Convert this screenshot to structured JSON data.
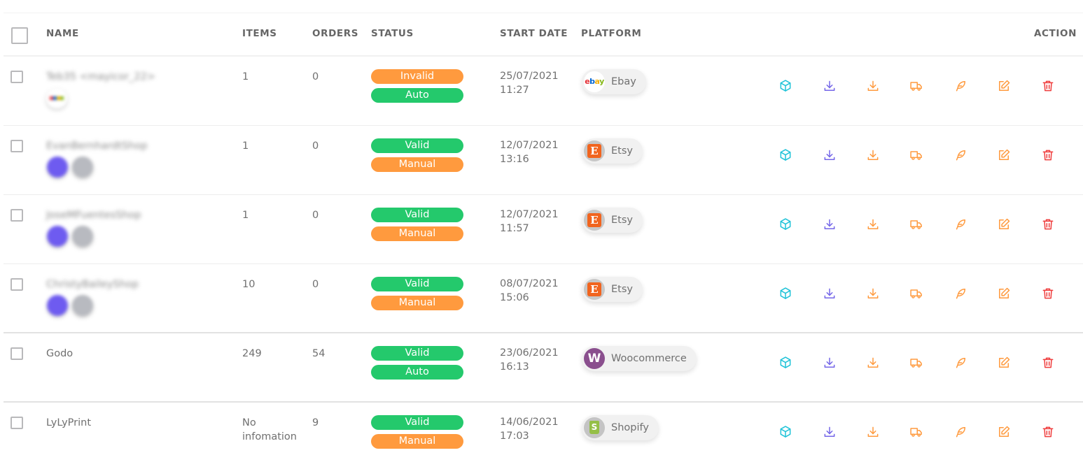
{
  "header": {
    "name": "NAME",
    "items": "ITEMS",
    "orders": "ORDERS",
    "status": "STATUS",
    "start_date": "START DATE",
    "platform": "PLATFORM",
    "action": "ACTION"
  },
  "rows": [
    {
      "name": "Teb35 <mayicor_22>",
      "items": "1",
      "orders": "0",
      "status": "Invalid",
      "mode": "Auto",
      "date": "25/07/2021",
      "time": "11:27",
      "platform": "Ebay"
    },
    {
      "name": "EvanBernhardtShop",
      "items": "1",
      "orders": "0",
      "status": "Valid",
      "mode": "Manual",
      "date": "12/07/2021",
      "time": "13:16",
      "platform": "Etsy"
    },
    {
      "name": "JoseMFuentesShop",
      "items": "1",
      "orders": "0",
      "status": "Valid",
      "mode": "Manual",
      "date": "12/07/2021",
      "time": "11:57",
      "platform": "Etsy"
    },
    {
      "name": "ChristyBaileyShop",
      "items": "10",
      "orders": "0",
      "status": "Valid",
      "mode": "Manual",
      "date": "08/07/2021",
      "time": "15:06",
      "platform": "Etsy"
    },
    {
      "name": "Godo",
      "items": "249",
      "orders": "54",
      "status": "Valid",
      "mode": "Auto",
      "date": "23/06/2021",
      "time": "16:13",
      "platform": "Woocommerce"
    },
    {
      "name": "LyLyPrint",
      "items_line1": "No",
      "items_line2": "infomation",
      "orders": "9",
      "status": "Valid",
      "mode": "Manual",
      "date": "14/06/2021",
      "time": "17:03",
      "platform": "Shopify"
    }
  ],
  "logos": {
    "ebay": "ebay",
    "etsy": "E",
    "woo": "W",
    "shopify": "S"
  },
  "colors": {
    "valid": "#24c96c",
    "invalid": "#ff9a3e",
    "auto": "#24c96c",
    "manual": "#ff9a3e",
    "cube": "#20c3d8",
    "download": "#7466e8",
    "orange_action": "#ff9a3e",
    "delete": "#ef3d3d"
  },
  "action_icons": [
    "cube-icon",
    "download-icon",
    "export-icon",
    "truck-icon",
    "feather-icon",
    "edit-icon",
    "trash-icon"
  ]
}
